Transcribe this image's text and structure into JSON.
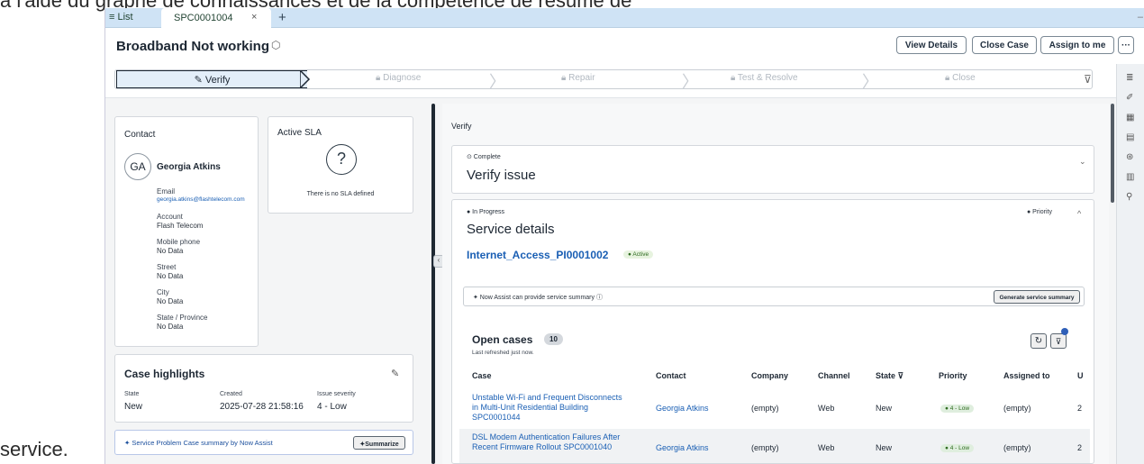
{
  "doc": {
    "top_text": "à l'aide du graphe de connaissances et de la compétence de résumé de",
    "bottom_text": "service."
  },
  "tabbar": {
    "list_label": "≡ List",
    "active_tab": "SPC0001004",
    "close": "×",
    "plus": "+",
    "dash": "–"
  },
  "header": {
    "title": "Broadband Not working",
    "view_details": "View Details",
    "close_case": "Close Case",
    "assign_to_me": "Assign to me",
    "more": "···"
  },
  "stepper": {
    "active": "✎ Verify",
    "steps": [
      "Diagnose",
      "Repair",
      "Test & Resolve",
      "Close"
    ]
  },
  "contact": {
    "title": "Contact",
    "initials": "GA",
    "name": "Georgia Atkins",
    "email_label": "Email",
    "email": "georgia.atkins@flashtelecom.com",
    "account_label": "Account",
    "account": "Flash Telecom",
    "mobile_label": "Mobile phone",
    "mobile": "No Data",
    "street_label": "Street",
    "street": "No Data",
    "city_label": "City",
    "city": "No Data",
    "state_label": "State / Province",
    "state": "No Data"
  },
  "sla": {
    "title": "Active SLA",
    "symbol": "?",
    "text": "There is no SLA defined"
  },
  "highlights": {
    "title": "Case highlights",
    "state_label": "State",
    "state": "New",
    "created_label": "Created",
    "created": "2025-07-28 21:58:16",
    "severity_label": "Issue severity",
    "severity": "4 - Low"
  },
  "summarize": {
    "text": "✦ Service Problem Case summary by Now Assist",
    "button": "✦Summarize"
  },
  "verify": {
    "section": "Verify",
    "status": "⊙ Complete",
    "heading": "Verify issue"
  },
  "service": {
    "status": "● In Progress",
    "priority": "● Priority",
    "heading": "Service details",
    "link": "Internet_Access_PI0001002",
    "badge": "● Active",
    "assist_text": "✦ Now Assist can provide service summary ⓘ",
    "assist_button": "Generate service summary"
  },
  "open_cases": {
    "title": "Open cases",
    "count": "10",
    "subtitle": "Last refreshed just now.",
    "columns": [
      "Case",
      "Contact",
      "Company",
      "Channel",
      "State ⊽",
      "Priority",
      "Assigned to",
      "U"
    ],
    "rows": [
      {
        "case": "Unstable Wi-Fi and Frequent Disconnects in Multi-Unit Residential Building SPC0001044",
        "contact": "Georgia Atkins",
        "company": "(empty)",
        "channel": "Web",
        "state": "New",
        "priority": "● 4 - Low",
        "assigned": "(empty)",
        "u": "2"
      },
      {
        "case": "DSL Modem Authentication Failures After Recent Firmware Rollout SPC0001040",
        "contact": "Georgia Atkins",
        "company": "(empty)",
        "channel": "Web",
        "state": "New",
        "priority": "● 4 - Low",
        "assigned": "(empty)",
        "u": "2"
      }
    ]
  },
  "icons": {
    "tag": "⬡",
    "filter": "⊽",
    "pencil": "✎",
    "refresh": "↻",
    "chevron_down": "⌄",
    "chevron_up": "^",
    "collapse": "‹",
    "rail": [
      "≣",
      "✐",
      "▦",
      "▤",
      "⊛",
      "▥",
      "⚲"
    ]
  }
}
